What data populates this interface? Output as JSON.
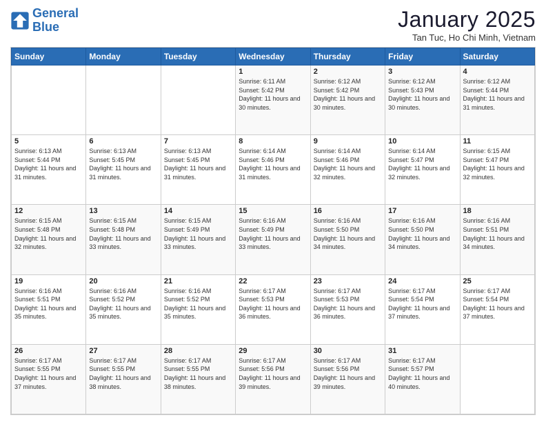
{
  "logo": {
    "line1": "General",
    "line2": "Blue"
  },
  "header": {
    "month_title": "January 2025",
    "location": "Tan Tuc, Ho Chi Minh, Vietnam"
  },
  "weekdays": [
    "Sunday",
    "Monday",
    "Tuesday",
    "Wednesday",
    "Thursday",
    "Friday",
    "Saturday"
  ],
  "weeks": [
    [
      {
        "day": "",
        "sunrise": "",
        "sunset": "",
        "daylight": ""
      },
      {
        "day": "",
        "sunrise": "",
        "sunset": "",
        "daylight": ""
      },
      {
        "day": "",
        "sunrise": "",
        "sunset": "",
        "daylight": ""
      },
      {
        "day": "1",
        "sunrise": "Sunrise: 6:11 AM",
        "sunset": "Sunset: 5:42 PM",
        "daylight": "Daylight: 11 hours and 30 minutes."
      },
      {
        "day": "2",
        "sunrise": "Sunrise: 6:12 AM",
        "sunset": "Sunset: 5:42 PM",
        "daylight": "Daylight: 11 hours and 30 minutes."
      },
      {
        "day": "3",
        "sunrise": "Sunrise: 6:12 AM",
        "sunset": "Sunset: 5:43 PM",
        "daylight": "Daylight: 11 hours and 30 minutes."
      },
      {
        "day": "4",
        "sunrise": "Sunrise: 6:12 AM",
        "sunset": "Sunset: 5:44 PM",
        "daylight": "Daylight: 11 hours and 31 minutes."
      }
    ],
    [
      {
        "day": "5",
        "sunrise": "Sunrise: 6:13 AM",
        "sunset": "Sunset: 5:44 PM",
        "daylight": "Daylight: 11 hours and 31 minutes."
      },
      {
        "day": "6",
        "sunrise": "Sunrise: 6:13 AM",
        "sunset": "Sunset: 5:45 PM",
        "daylight": "Daylight: 11 hours and 31 minutes."
      },
      {
        "day": "7",
        "sunrise": "Sunrise: 6:13 AM",
        "sunset": "Sunset: 5:45 PM",
        "daylight": "Daylight: 11 hours and 31 minutes."
      },
      {
        "day": "8",
        "sunrise": "Sunrise: 6:14 AM",
        "sunset": "Sunset: 5:46 PM",
        "daylight": "Daylight: 11 hours and 31 minutes."
      },
      {
        "day": "9",
        "sunrise": "Sunrise: 6:14 AM",
        "sunset": "Sunset: 5:46 PM",
        "daylight": "Daylight: 11 hours and 32 minutes."
      },
      {
        "day": "10",
        "sunrise": "Sunrise: 6:14 AM",
        "sunset": "Sunset: 5:47 PM",
        "daylight": "Daylight: 11 hours and 32 minutes."
      },
      {
        "day": "11",
        "sunrise": "Sunrise: 6:15 AM",
        "sunset": "Sunset: 5:47 PM",
        "daylight": "Daylight: 11 hours and 32 minutes."
      }
    ],
    [
      {
        "day": "12",
        "sunrise": "Sunrise: 6:15 AM",
        "sunset": "Sunset: 5:48 PM",
        "daylight": "Daylight: 11 hours and 32 minutes."
      },
      {
        "day": "13",
        "sunrise": "Sunrise: 6:15 AM",
        "sunset": "Sunset: 5:48 PM",
        "daylight": "Daylight: 11 hours and 33 minutes."
      },
      {
        "day": "14",
        "sunrise": "Sunrise: 6:15 AM",
        "sunset": "Sunset: 5:49 PM",
        "daylight": "Daylight: 11 hours and 33 minutes."
      },
      {
        "day": "15",
        "sunrise": "Sunrise: 6:16 AM",
        "sunset": "Sunset: 5:49 PM",
        "daylight": "Daylight: 11 hours and 33 minutes."
      },
      {
        "day": "16",
        "sunrise": "Sunrise: 6:16 AM",
        "sunset": "Sunset: 5:50 PM",
        "daylight": "Daylight: 11 hours and 34 minutes."
      },
      {
        "day": "17",
        "sunrise": "Sunrise: 6:16 AM",
        "sunset": "Sunset: 5:50 PM",
        "daylight": "Daylight: 11 hours and 34 minutes."
      },
      {
        "day": "18",
        "sunrise": "Sunrise: 6:16 AM",
        "sunset": "Sunset: 5:51 PM",
        "daylight": "Daylight: 11 hours and 34 minutes."
      }
    ],
    [
      {
        "day": "19",
        "sunrise": "Sunrise: 6:16 AM",
        "sunset": "Sunset: 5:51 PM",
        "daylight": "Daylight: 11 hours and 35 minutes."
      },
      {
        "day": "20",
        "sunrise": "Sunrise: 6:16 AM",
        "sunset": "Sunset: 5:52 PM",
        "daylight": "Daylight: 11 hours and 35 minutes."
      },
      {
        "day": "21",
        "sunrise": "Sunrise: 6:16 AM",
        "sunset": "Sunset: 5:52 PM",
        "daylight": "Daylight: 11 hours and 35 minutes."
      },
      {
        "day": "22",
        "sunrise": "Sunrise: 6:17 AM",
        "sunset": "Sunset: 5:53 PM",
        "daylight": "Daylight: 11 hours and 36 minutes."
      },
      {
        "day": "23",
        "sunrise": "Sunrise: 6:17 AM",
        "sunset": "Sunset: 5:53 PM",
        "daylight": "Daylight: 11 hours and 36 minutes."
      },
      {
        "day": "24",
        "sunrise": "Sunrise: 6:17 AM",
        "sunset": "Sunset: 5:54 PM",
        "daylight": "Daylight: 11 hours and 37 minutes."
      },
      {
        "day": "25",
        "sunrise": "Sunrise: 6:17 AM",
        "sunset": "Sunset: 5:54 PM",
        "daylight": "Daylight: 11 hours and 37 minutes."
      }
    ],
    [
      {
        "day": "26",
        "sunrise": "Sunrise: 6:17 AM",
        "sunset": "Sunset: 5:55 PM",
        "daylight": "Daylight: 11 hours and 37 minutes."
      },
      {
        "day": "27",
        "sunrise": "Sunrise: 6:17 AM",
        "sunset": "Sunset: 5:55 PM",
        "daylight": "Daylight: 11 hours and 38 minutes."
      },
      {
        "day": "28",
        "sunrise": "Sunrise: 6:17 AM",
        "sunset": "Sunset: 5:55 PM",
        "daylight": "Daylight: 11 hours and 38 minutes."
      },
      {
        "day": "29",
        "sunrise": "Sunrise: 6:17 AM",
        "sunset": "Sunset: 5:56 PM",
        "daylight": "Daylight: 11 hours and 39 minutes."
      },
      {
        "day": "30",
        "sunrise": "Sunrise: 6:17 AM",
        "sunset": "Sunset: 5:56 PM",
        "daylight": "Daylight: 11 hours and 39 minutes."
      },
      {
        "day": "31",
        "sunrise": "Sunrise: 6:17 AM",
        "sunset": "Sunset: 5:57 PM",
        "daylight": "Daylight: 11 hours and 40 minutes."
      },
      {
        "day": "",
        "sunrise": "",
        "sunset": "",
        "daylight": ""
      }
    ]
  ]
}
